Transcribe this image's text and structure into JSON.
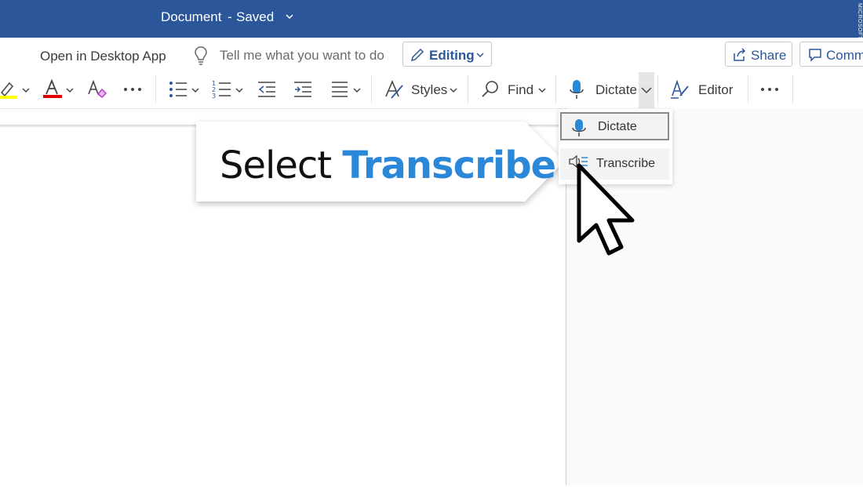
{
  "titlebar": {
    "doc_title": "Document",
    "separator": "-",
    "doc_status": "Saved",
    "watermark": "MICROSOFT"
  },
  "commandbar": {
    "open_desktop": "Open in Desktop App",
    "tellme_placeholder": "Tell me what you want to do",
    "editing_label": "Editing",
    "share_label": "Share",
    "comments_label": "Comm"
  },
  "ribbon": {
    "styles_label": "Styles",
    "find_label": "Find",
    "dictate_label": "Dictate",
    "editor_label": "Editor",
    "highlight_color": "#ffff00",
    "font_color": "#e00000"
  },
  "callout": {
    "prefix": "Select",
    "highlight": "Transcribe"
  },
  "dictate_menu": {
    "items": [
      {
        "label": "Dictate"
      },
      {
        "label": "Transcribe"
      }
    ]
  },
  "colors": {
    "titlebar_bg": "#2b579a",
    "accent": "#2b88d8"
  }
}
